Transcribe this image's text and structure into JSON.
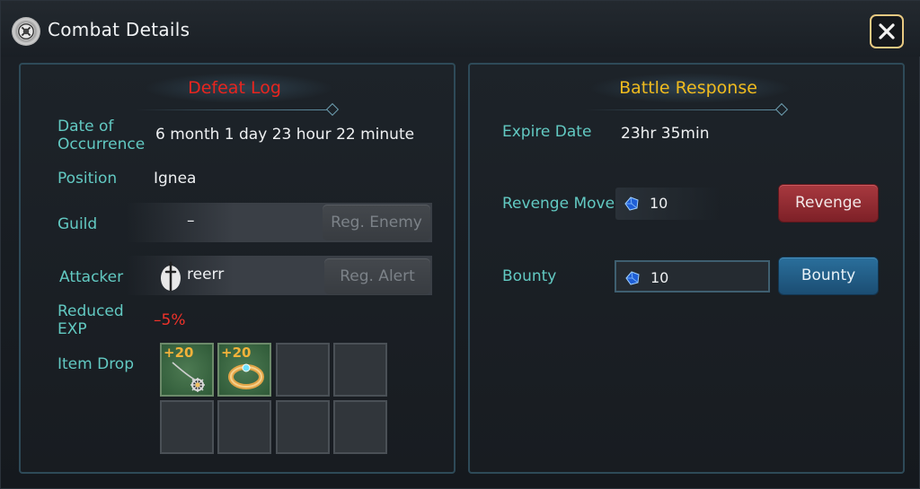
{
  "window": {
    "title": "Combat Details",
    "title_icon": "crest-icon",
    "close_icon": "close-icon"
  },
  "defeat_log": {
    "title": "Defeat Log",
    "title_color": "#e8251f",
    "date_label_line1": "Date of",
    "date_label_line2": "Occurrence",
    "date_value": "6 month 1 day 23 hour 22 minute",
    "position_label": "Position",
    "position_value": "Ignea",
    "guild_label": "Guild",
    "guild_value": "–",
    "reg_enemy_label": "Reg. Enemy",
    "attacker_label": "Attacker",
    "attacker_value": "reerr",
    "reg_alert_label": "Reg. Alert",
    "reduced_exp_label_line1": "Reduced",
    "reduced_exp_label_line2": "EXP",
    "reduced_exp_value": "–5%",
    "item_drop_label": "Item Drop",
    "items": [
      {
        "name": "necklace",
        "enhance": "+20",
        "icon": "necklace-icon"
      },
      {
        "name": "ring",
        "enhance": "+20",
        "icon": "ring-icon"
      }
    ]
  },
  "battle_response": {
    "title": "Battle Response",
    "title_color": "#f0bb1e",
    "expire_label": "Expire Date",
    "expire_value": "23hr 35min",
    "revenge_move_label": "Revenge Move",
    "revenge_move_cost": "10",
    "revenge_button": "Revenge",
    "bounty_label": "Bounty",
    "bounty_amount": "10",
    "bounty_button": "Bounty",
    "currency_icon": "blue-gem-icon"
  }
}
